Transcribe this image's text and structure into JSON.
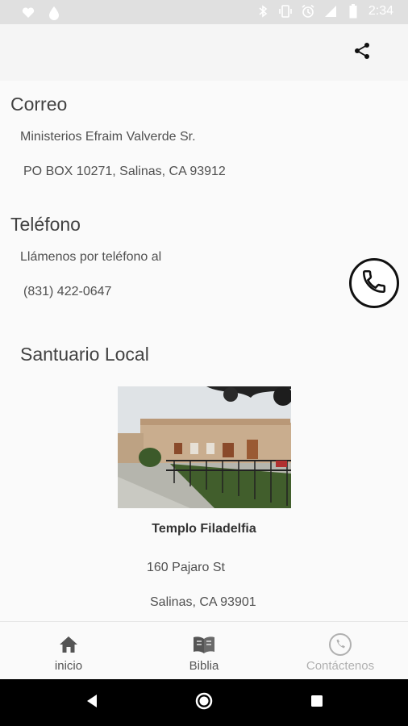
{
  "status_bar": {
    "time": "2:34",
    "left_icons": [
      "heart-icon",
      "drop-icon"
    ],
    "right_icons": [
      "bluetooth-icon",
      "vibrate-icon",
      "alarm-icon",
      "signal-icon",
      "battery-icon"
    ]
  },
  "app_bar": {
    "share_icon": "share-icon"
  },
  "mail": {
    "title": "Correo",
    "line1": "Ministerios Efraim Valverde Sr.",
    "line2": "PO BOX 10271, Salinas, CA 93912"
  },
  "phone": {
    "title": "Teléfono",
    "line1": "Llámenos por teléfono al",
    "number": "(831) 422-0647",
    "call_icon": "phone-icon"
  },
  "sanctuary": {
    "title": "Santuario Local",
    "photo_caption": "Templo Filadelfia",
    "address1": "160 Pajaro St",
    "address2": "Salinas, CA 93901"
  },
  "bottom_nav": {
    "items": [
      {
        "label": "inicio",
        "icon": "home-icon"
      },
      {
        "label": "Biblia",
        "icon": "book-icon"
      },
      {
        "label": "Contáctenos",
        "icon": "phone-icon"
      }
    ]
  },
  "colors": {
    "status_bar": "#e0e0e0",
    "app_bar": "#f5f5f5",
    "background": "#fafafa",
    "android_nav": "#000000"
  }
}
